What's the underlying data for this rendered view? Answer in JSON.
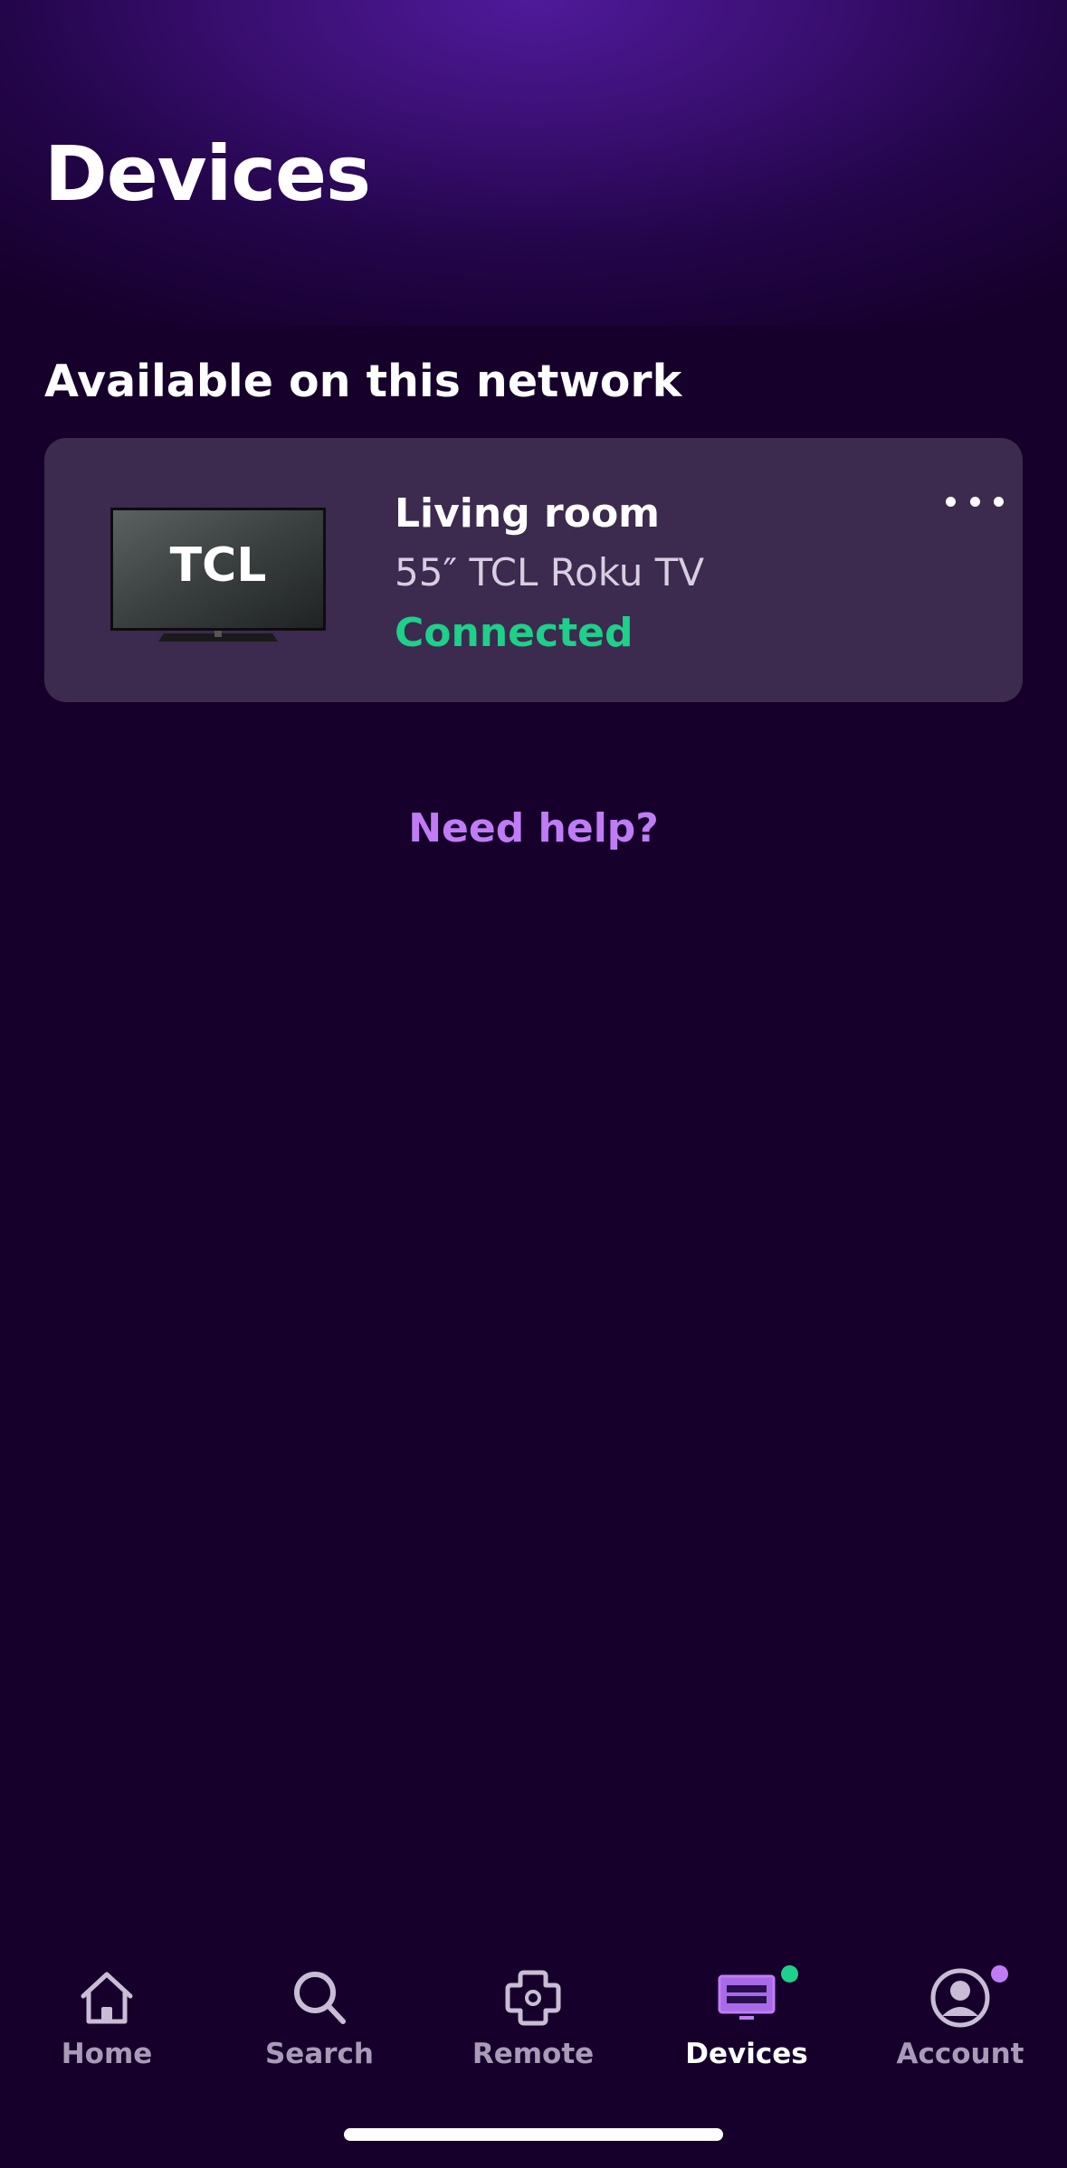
{
  "header": {
    "title": "Devices"
  },
  "section": {
    "title": "Available on this network"
  },
  "device": {
    "name": "Living room",
    "model": "55″ TCL Roku TV",
    "status": "Connected",
    "brand_logo_text": "TCL",
    "status_color": "#1ed089"
  },
  "help": {
    "label": "Need help?",
    "color": "#c07cf5"
  },
  "tabs": [
    {
      "label": "Home",
      "icon": "home-icon",
      "active": false
    },
    {
      "label": "Search",
      "icon": "search-icon",
      "active": false
    },
    {
      "label": "Remote",
      "icon": "remote-icon",
      "active": false
    },
    {
      "label": "Devices",
      "icon": "devices-icon",
      "active": true,
      "badge_color": "#1ed089"
    },
    {
      "label": "Account",
      "icon": "account-icon",
      "active": false,
      "badge_color": "#c07cf5"
    }
  ],
  "colors": {
    "background": "#16002b",
    "card": "#3c2a4f",
    "accent": "#c07cf5",
    "tab_inactive": "#a99bb8"
  }
}
